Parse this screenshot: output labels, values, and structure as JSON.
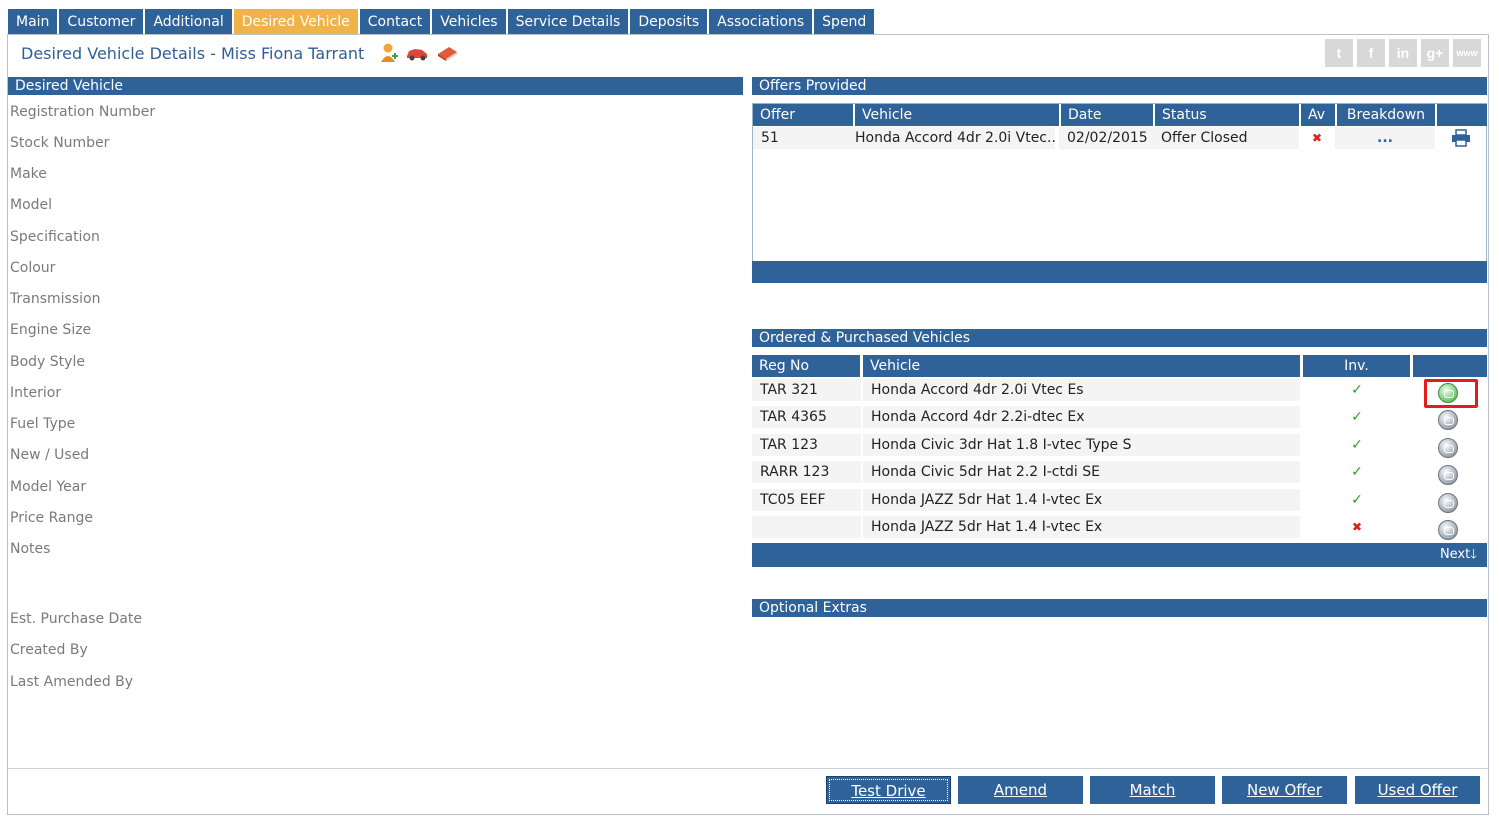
{
  "tabs": [
    {
      "label": "Main",
      "active": false
    },
    {
      "label": "Customer",
      "active": false
    },
    {
      "label": "Additional",
      "active": false
    },
    {
      "label": "Desired Vehicle",
      "active": true
    },
    {
      "label": "Contact",
      "active": false
    },
    {
      "label": "Vehicles",
      "active": false
    },
    {
      "label": "Service Details",
      "active": false
    },
    {
      "label": "Deposits",
      "active": false
    },
    {
      "label": "Associations",
      "active": false
    },
    {
      "label": "Spend",
      "active": false
    }
  ],
  "page_title": "Desired Vehicle Details  - Miss Fiona Tarrant",
  "header_icons": [
    "add-person-icon",
    "car-icon",
    "book-icon"
  ],
  "social_icons": [
    "twitter-icon",
    "facebook-icon",
    "linkedin-icon",
    "google-plus-icon",
    "www-icon"
  ],
  "desired_vehicle": {
    "title": "Desired Vehicle",
    "fields": [
      "Registration Number",
      "Stock Number",
      "Make",
      "Model",
      "Specification",
      "Colour",
      "Transmission",
      "Engine Size",
      "Body Style",
      "Interior",
      "Fuel Type",
      "New / Used",
      "Model Year",
      "Price Range",
      "Notes",
      "Est. Purchase Date",
      "Created By",
      "Last Amended By"
    ]
  },
  "offers": {
    "title": "Offers Provided",
    "columns": [
      "Offer",
      "Vehicle",
      "Date",
      "Status",
      "Av",
      "Breakdown"
    ],
    "rows": [
      {
        "offer": "51",
        "vehicle": "Honda Accord 4dr 2.0i Vtec...",
        "date": "02/02/2015",
        "status": "Offer Closed",
        "av": "✖",
        "breakdown": "..."
      }
    ]
  },
  "ordered": {
    "title": "Ordered & Purchased Vehicles",
    "columns": [
      "Reg No",
      "Vehicle",
      "Inv."
    ],
    "rows": [
      {
        "reg": "TAR 321",
        "vehicle": "Honda Accord 4dr 2.0i Vtec Es",
        "inv": "✓",
        "inv_ok": true
      },
      {
        "reg": "TAR 4365",
        "vehicle": "Honda Accord 4dr 2.2i-dtec Ex",
        "inv": "✓",
        "inv_ok": true
      },
      {
        "reg": "TAR 123",
        "vehicle": "Honda Civic 3dr Hat 1.8 I-vtec Type S",
        "inv": "✓",
        "inv_ok": true
      },
      {
        "reg": "RARR 123",
        "vehicle": "Honda Civic 5dr Hat 2.2 I-ctdi SE",
        "inv": "✓",
        "inv_ok": true
      },
      {
        "reg": "TC05 EEF",
        "vehicle": "Honda JAZZ 5dr Hat 1.4 I-vtec Ex",
        "inv": "✓",
        "inv_ok": true
      },
      {
        "reg": "",
        "vehicle": "Honda JAZZ 5dr Hat 1.4 I-vtec Ex",
        "inv": "✖",
        "inv_ok": false
      }
    ],
    "next_label": "Next🡓"
  },
  "optional_extras": {
    "title": "Optional Extras"
  },
  "buttons": {
    "test_drive": "Test Drive",
    "amend": "Amend",
    "match": "Match",
    "new_offer": "New Offer",
    "used_offer": "Used Offer"
  },
  "colors": {
    "accent": "#2f6299",
    "active_tab": "#f0b34a",
    "highlight": "#e31c1c"
  }
}
